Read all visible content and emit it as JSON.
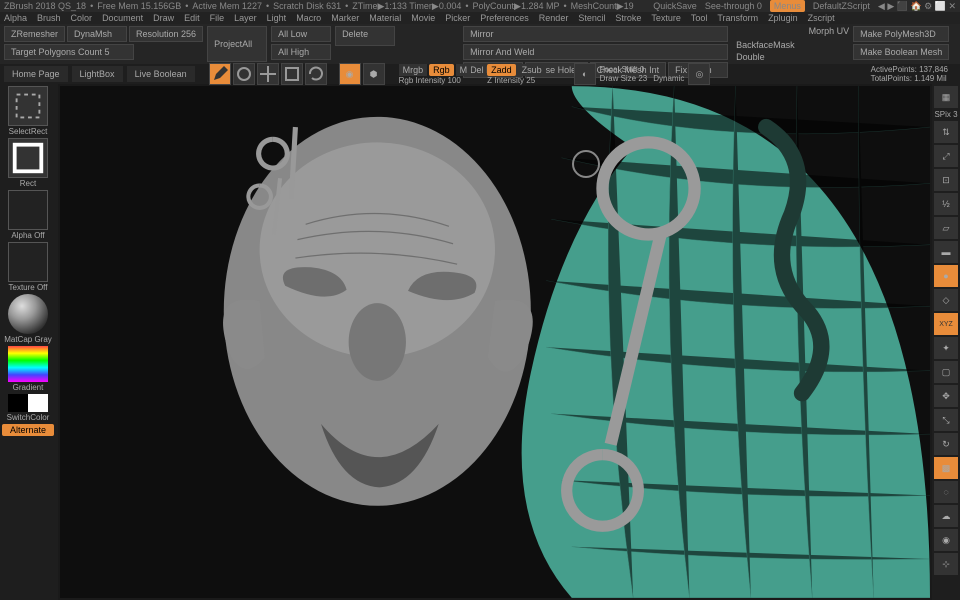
{
  "title_bar": {
    "version": "ZBrush 2018 QS_18",
    "free_mem": "Free Mem 15.156GB",
    "active_mem": "Active Mem 1227",
    "scratch": "Scratch Disk 631",
    "ztime": "ZTime▶1:133 Timer▶0.004",
    "polycount": "PolyCount▶1.284 MP",
    "meshcount": "MeshCount▶19",
    "quicksave": "QuickSave",
    "seethrough": "See-through  0",
    "menus": "Menus",
    "script": "DefaultZScript"
  },
  "menu": [
    "Alpha",
    "Brush",
    "Color",
    "Document",
    "Draw",
    "Edit",
    "File",
    "Layer",
    "Light",
    "Macro",
    "Marker",
    "Material",
    "Movie",
    "Picker",
    "Preferences",
    "Render",
    "Stencil",
    "Stroke",
    "Texture",
    "Tool",
    "Transform",
    "Zplugin",
    "Zscript"
  ],
  "secondary": {
    "zremesher": "ZRemesher",
    "dynamesh": "DynaMsh",
    "resolution": "Resolution 256",
    "target": "Target Polygons Count 5",
    "projectall": "ProjectAll",
    "alllow": "All Low",
    "allhigh": "All High",
    "delete": "Delete",
    "mirror": "Mirror",
    "mirrorweld": "Mirror And Weld",
    "delhidden": "Del Hidden",
    "closeholes": "Close Holes",
    "checkmesh": "Check Mesh Int",
    "fixmesh": "Fix Mesh",
    "backfacemask": "BackfaceMask",
    "double": "Double",
    "morphuv": "Morph UV",
    "makepolymesh": "Make PolyMesh3D",
    "makeboolean": "Make Boolean Mesh"
  },
  "tabs": {
    "home": "Home Page",
    "lightbox": "LightBox",
    "liveboolean": "Live Boolean"
  },
  "tools": {
    "mrgb": "Mrgb",
    "rgb": "Rgb",
    "m": "M",
    "zadd": "Zadd",
    "zsub": "Zsub",
    "rgbintensity": "Rgb Intensity 100",
    "zintensity": "Z Intensity 25",
    "focalshift": "Focal Shift 0",
    "drawsize": "Draw Size 23",
    "dynamic": "Dynamic",
    "activepoints": "ActivePoints: 137,846",
    "totalpoints": "TotalPoints: 1.149 Mil"
  },
  "left": {
    "selectrect": "SelectRect",
    "rect": "Rect",
    "alphaoff": "Alpha Off",
    "textureoff": "Texture Off",
    "matcap": "MatCap Gray",
    "gradient": "Gradient",
    "switchcolor": "SwitchColor",
    "alternate": "Alternate"
  },
  "right": {
    "spix": "SPix 3"
  },
  "colors": {
    "accent": "#e88c3a",
    "teal": "#4db39e"
  }
}
